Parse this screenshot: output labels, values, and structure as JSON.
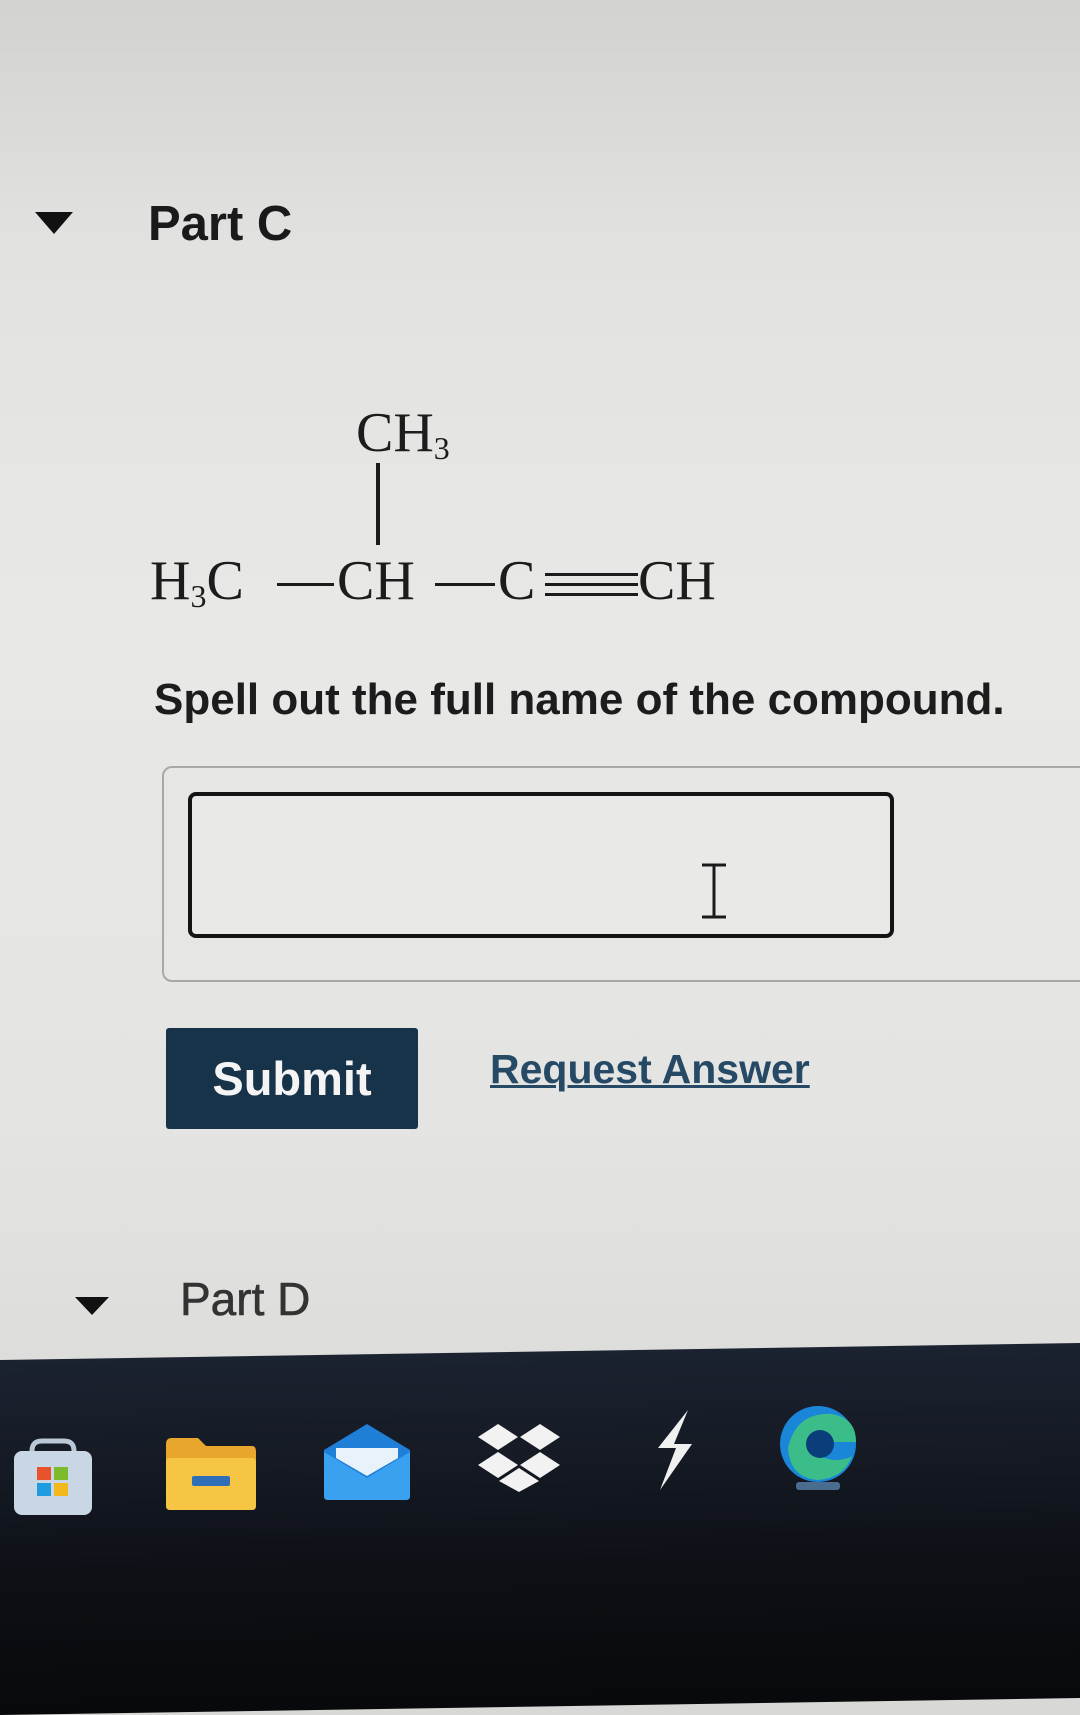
{
  "part_c": {
    "title": "Part C"
  },
  "structure": {
    "top_group": "CH",
    "top_sub": "3",
    "left_group": "H",
    "left_sub": "3",
    "left_group_end": "C",
    "center_group": "CH",
    "alkyne_c": "C",
    "terminal_group": "CH"
  },
  "question": {
    "prompt": "Spell out the full name of the compound.",
    "answer_value": ""
  },
  "actions": {
    "submit_label": "Submit",
    "request_answer_label": "Request Answer"
  },
  "part_d": {
    "title": "Part D"
  },
  "taskbar": {
    "icons": [
      "store-icon",
      "file-explorer-icon",
      "mail-icon",
      "dropbox-icon",
      "app-icon",
      "edge-icon"
    ]
  },
  "colors": {
    "submit_bg": "#173349",
    "link": "#264a66",
    "page_bg": "#e6e6e4",
    "taskbar_bg": "#151a24"
  }
}
